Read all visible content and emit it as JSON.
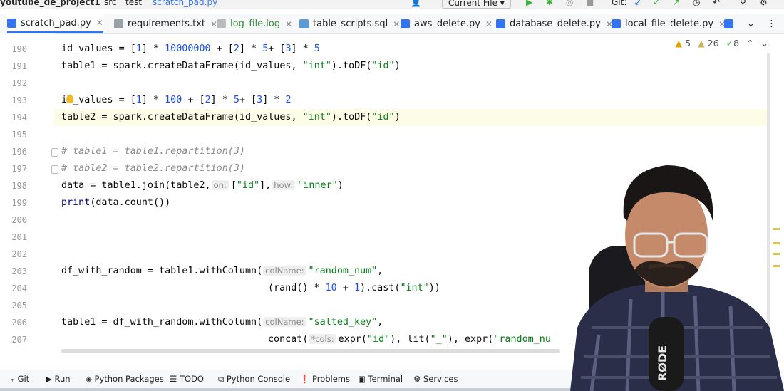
{
  "title_bar": {
    "project": "youtube_de_project1",
    "folder_src": "src",
    "folder_test": "test",
    "file": "scratch_pad.py",
    "run_config": "Current File",
    "vcs": "Git:"
  },
  "tabs": [
    {
      "label": "scratch_pad.py",
      "active": true
    },
    {
      "label": "requirements.txt"
    },
    {
      "label": "log_file.log"
    },
    {
      "label": "table_scripts.sql"
    },
    {
      "label": "aws_delete.py"
    },
    {
      "label": "database_delete.py"
    },
    {
      "label": "local_file_delete.py"
    }
  ],
  "inspections": {
    "warnings": "5",
    "weak_warnings": "26",
    "typos": "8"
  },
  "line_numbers": [
    "190",
    "191",
    "192",
    "193",
    "194",
    "195",
    "196",
    "197",
    "198",
    "199",
    "200",
    "201",
    "202",
    "203",
    "204",
    "205",
    "206",
    "207"
  ],
  "code": {
    "l190_var": "id_values",
    "l190_op": " = [",
    "l190_n1": "1",
    "l190_mid1": "] * ",
    "l190_n2": "10000000",
    "l190_mid2": " + [",
    "l190_n3": "2",
    "l190_mid3": "] * ",
    "l190_n4": "5",
    "l190_mid4": "+ [",
    "l190_n5": "3",
    "l190_mid5": "] * ",
    "l190_n6": "5",
    "l191_pre": "table1 = spark.createDataFrame(id_values, ",
    "l191_s1": "\"int\"",
    "l191_mid": ").toDF(",
    "l191_s2": "\"id\"",
    "l191_end": ")",
    "l193_var": "id_values",
    "l193_op": " = [",
    "l193_n1": "1",
    "l193_mid1": "] * ",
    "l193_n2": "100",
    "l193_mid2": " + [",
    "l193_n3": "2",
    "l193_mid3": "] * ",
    "l193_n4": "5",
    "l193_mid4": "+ [",
    "l193_n5": "3",
    "l193_mid5": "] * ",
    "l193_n6": "2",
    "l194_pre": "table2 = spark.createDataFrame(id_values, ",
    "l194_s1": "\"int\"",
    "l194_mid": ").toDF(",
    "l194_s2": "\"id\"",
    "l194_end": ")",
    "l196": "# table1 = table1.repartition(3)",
    "l197": "# table2 = table2.repartition(3)",
    "l198_pre": "data = table1.join(table2,",
    "l198_hint1": "on:",
    "l198_a1": "[",
    "l198_s1": "\"id\"",
    "l198_a2": "],",
    "l198_hint2": "how:",
    "l198_s2": "\"inner\"",
    "l198_end": ")",
    "l199_kw": "print",
    "l199_rest": "(data.count())",
    "l203_pre": "df_with_random = table1.withColumn(",
    "l203_hint": "colName:",
    "l203_s": "\"random_num\"",
    "l203_end": ",",
    "l204_pre": "(rand() * ",
    "l204_n": "10",
    "l204_mid": " + ",
    "l204_n2": "1",
    "l204_mid2": ").cast(",
    "l204_s": "\"int\"",
    "l204_end": "))",
    "l206_pre": "table1 = df_with_random.withColumn(",
    "l206_hint": "colName:",
    "l206_s": "\"salted_key\"",
    "l206_end": ",",
    "l207_pre": "concat(",
    "l207_hint": "*cols:",
    "l207_a": "expr(",
    "l207_s1": "\"id\"",
    "l207_b": "), lit(",
    "l207_s2": "\"_\"",
    "l207_c": "), expr(",
    "l207_s3": "\"random_nu"
  },
  "status_bar": {
    "git": "Git",
    "run": "Run",
    "packages": "Python Packages",
    "todo": "TODO",
    "console": "Python Console",
    "problems": "Problems",
    "terminal": "Terminal",
    "services": "Services"
  },
  "overlay": {
    "mic_brand": "RØDE"
  },
  "colors": {
    "accent": "#3574f0",
    "string": "#067d17",
    "number": "#1750eb",
    "comment": "#8c8c8c",
    "current_line": "#fdfce6"
  }
}
